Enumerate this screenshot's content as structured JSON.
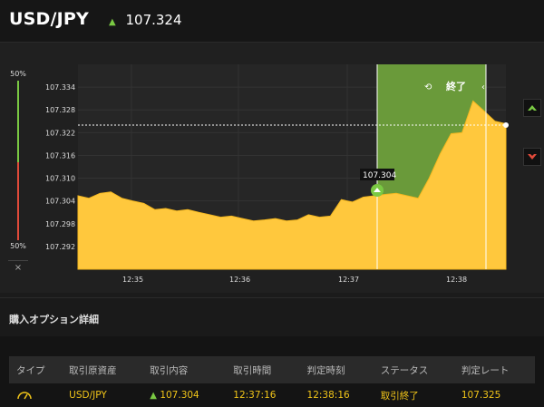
{
  "header": {
    "pair": "USD/JPY",
    "rate": "107.324",
    "trend_color": "#7ac943"
  },
  "sidebar": {
    "up_pct": "50%",
    "down_pct": "50%",
    "close_label": "×"
  },
  "chart": {
    "y_ticks": [
      "107.334",
      "107.328",
      "107.322",
      "107.316",
      "107.310",
      "107.304",
      "107.298",
      "107.292"
    ],
    "x_ticks": [
      "12:35",
      "12:36",
      "12:37",
      "12:38"
    ],
    "end_label": "終了",
    "entry_tooltip": "107.304",
    "area_color": "#ffc83d",
    "window_color": "#6a9a3a"
  },
  "chart_data": {
    "type": "area",
    "ylim": [
      107.286,
      107.34
    ],
    "values": [
      107.305,
      107.305,
      107.306,
      107.306,
      107.305,
      107.304,
      107.303,
      107.302,
      107.302,
      107.301,
      107.302,
      107.301,
      107.3,
      107.3,
      107.3,
      107.299,
      107.299,
      107.299,
      107.299,
      107.299,
      107.299,
      107.3,
      107.3,
      107.3,
      107.304,
      107.304,
      107.305,
      107.305,
      107.306,
      107.306,
      107.305,
      107.305,
      107.31,
      107.316,
      107.322,
      107.322,
      107.33,
      107.328,
      107.325,
      107.324
    ],
    "current_rate": 107.324,
    "entry_rate": 107.304
  },
  "section": {
    "title": "購入オプション詳細"
  },
  "table": {
    "headers": [
      "タイプ",
      "取引原資産",
      "取引内容",
      "取引時間",
      "判定時刻",
      "ステータス",
      "判定レート"
    ],
    "row": {
      "asset": "USD/JPY",
      "trade": "107.304",
      "time": "12:37:16",
      "judge": "12:38:16",
      "status": "取引終了",
      "rate": "107.325"
    }
  }
}
